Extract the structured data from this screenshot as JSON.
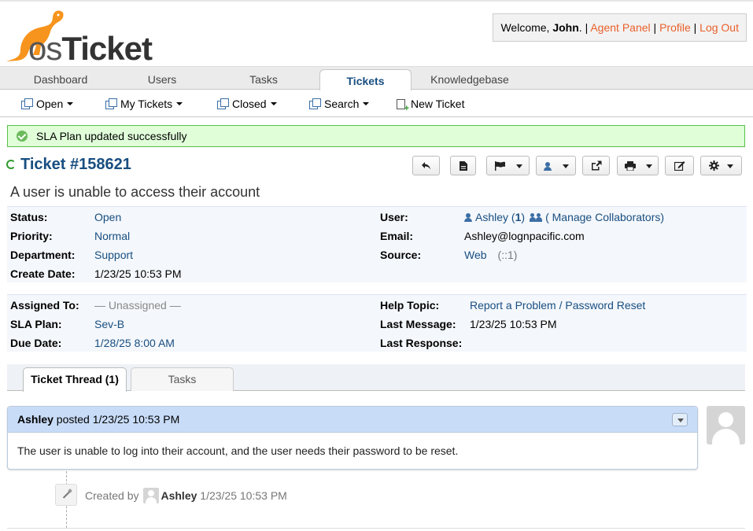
{
  "header": {
    "logo_text_os": "os",
    "logo_text_ticket": "Ticket",
    "welcome_prefix": "Welcome, ",
    "welcome_user": "John",
    "welcome_suffix": ".",
    "agent_panel": "Agent Panel",
    "profile": "Profile",
    "logout": "Log Out",
    "separator": "|"
  },
  "nav": {
    "tabs": [
      {
        "label": "Dashboard"
      },
      {
        "label": "Users"
      },
      {
        "label": "Tasks"
      },
      {
        "label": "Tickets",
        "active": true
      },
      {
        "label": "Knowledgebase"
      }
    ]
  },
  "subnav": {
    "items": [
      {
        "label": "Open",
        "icon": "copy-icon",
        "dropdown": true
      },
      {
        "label": "My Tickets",
        "icon": "copy-icon",
        "dropdown": true
      },
      {
        "label": "Closed",
        "icon": "copy-icon",
        "dropdown": true
      },
      {
        "label": "Search",
        "icon": "copy-icon",
        "dropdown": true
      },
      {
        "label": "New Ticket",
        "icon": "new-ticket-icon",
        "dropdown": false
      }
    ]
  },
  "alert": {
    "message": "SLA Plan updated successfully",
    "icon": "check-circle-icon"
  },
  "ticket": {
    "title": "Ticket #158621",
    "subject": "A user is unable to access their account",
    "toolbar_icons": [
      "reply-icon",
      "note-icon",
      "flag-icon",
      "assign-icon",
      "transfer-icon",
      "print-icon",
      "edit-icon",
      "gear-icon"
    ]
  },
  "info1": {
    "status_label": "Status:",
    "status_value": "Open",
    "priority_label": "Priority:",
    "priority_value": "Normal",
    "department_label": "Department:",
    "department_value": "Support",
    "create_date_label": "Create Date:",
    "create_date_value": "1/23/25 10:53 PM",
    "user_label": "User:",
    "user_name": "Ashley",
    "user_count_open": "(",
    "user_count": "1",
    "user_count_close": ")",
    "collaborators": "( Manage Collaborators)",
    "email_label": "Email:",
    "email_value": "Ashley@lognpacific.com",
    "source_label": "Source:",
    "source_value": "Web",
    "source_ip": "(::1)"
  },
  "info2": {
    "assigned_label": "Assigned To:",
    "assigned_value": "— Unassigned —",
    "sla_label": "SLA Plan:",
    "sla_value": "Sev-B",
    "due_label": "Due Date:",
    "due_value": "1/28/25 8:00 AM",
    "help_topic_label": "Help Topic:",
    "help_topic_value": "Report a Problem / Password Reset",
    "last_message_label": "Last Message:",
    "last_message_value": "1/23/25 10:53 PM",
    "last_response_label": "Last Response:"
  },
  "thread_tabs": [
    {
      "label": "Ticket Thread (1)",
      "active": true
    },
    {
      "label": "Tasks",
      "active": false
    }
  ],
  "entry": {
    "author": "Ashley",
    "posted": " posted 1/23/25 10:53 PM",
    "body": "The user is unable to log into their account, and the user needs their password to be reset."
  },
  "event": {
    "created_by": "Created by",
    "author": "Ashley",
    "time": "1/23/25 10:53 PM"
  },
  "colors": {
    "brand_orange": "#e9602a",
    "link_blue": "#184e81",
    "success_bg": "#e0ffd9",
    "thread_header_bg": "#c8dcf8"
  }
}
